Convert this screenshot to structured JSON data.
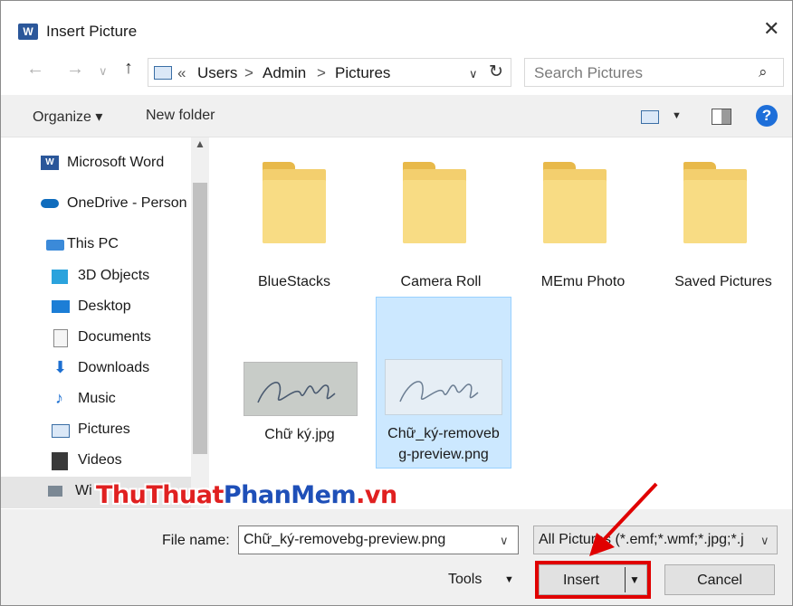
{
  "window": {
    "title": "Insert Picture",
    "app_icon_letter": "W"
  },
  "address": {
    "overflow": "«",
    "crumbs": [
      "Users",
      "Admin",
      "Pictures"
    ],
    "separator": ">"
  },
  "search": {
    "placeholder": "Search Pictures"
  },
  "toolbar": {
    "organize": "Organize ▾",
    "new_folder": "New folder"
  },
  "sidebar": {
    "items": [
      {
        "label": "Microsoft Word",
        "icon": "word-icon"
      },
      {
        "label": "OneDrive - Person",
        "icon": "cloud-icon"
      },
      {
        "label": "This PC",
        "icon": "computer-icon"
      },
      {
        "label": "3D Objects",
        "icon": "cube-icon"
      },
      {
        "label": "Desktop",
        "icon": "desktop-icon"
      },
      {
        "label": "Documents",
        "icon": "document-icon"
      },
      {
        "label": "Downloads",
        "icon": "download-icon"
      },
      {
        "label": "Music",
        "icon": "music-icon"
      },
      {
        "label": "Pictures",
        "icon": "pictures-icon"
      },
      {
        "label": "Videos",
        "icon": "video-icon"
      },
      {
        "label": "Wi",
        "icon": "drive-icon"
      }
    ]
  },
  "files": {
    "folders": [
      "BlueStacks",
      "Camera Roll",
      "MEmu Photo",
      "Saved Pictures"
    ],
    "images": [
      {
        "name": "Chữ ký.jpg"
      },
      {
        "name_line1": "Chữ_ký-removeb",
        "name_line2": "g-preview.png",
        "selected": true
      }
    ]
  },
  "footer": {
    "file_name_label": "File name:",
    "file_name_value": "Chữ_ký-removebg-preview.png",
    "filter_value": "All Pictures (*.emf;*.wmf;*.jpg;*.j",
    "tools": "Tools",
    "insert": "Insert",
    "cancel": "Cancel"
  },
  "watermark": {
    "part1": "ThuThuat",
    "part2": "PhanMem",
    "part3": ".vn"
  },
  "colors": {
    "accent": "#1e6fd9",
    "selection": "#cce8ff",
    "highlight": "#e00000",
    "folder": "#f3cf6e"
  }
}
